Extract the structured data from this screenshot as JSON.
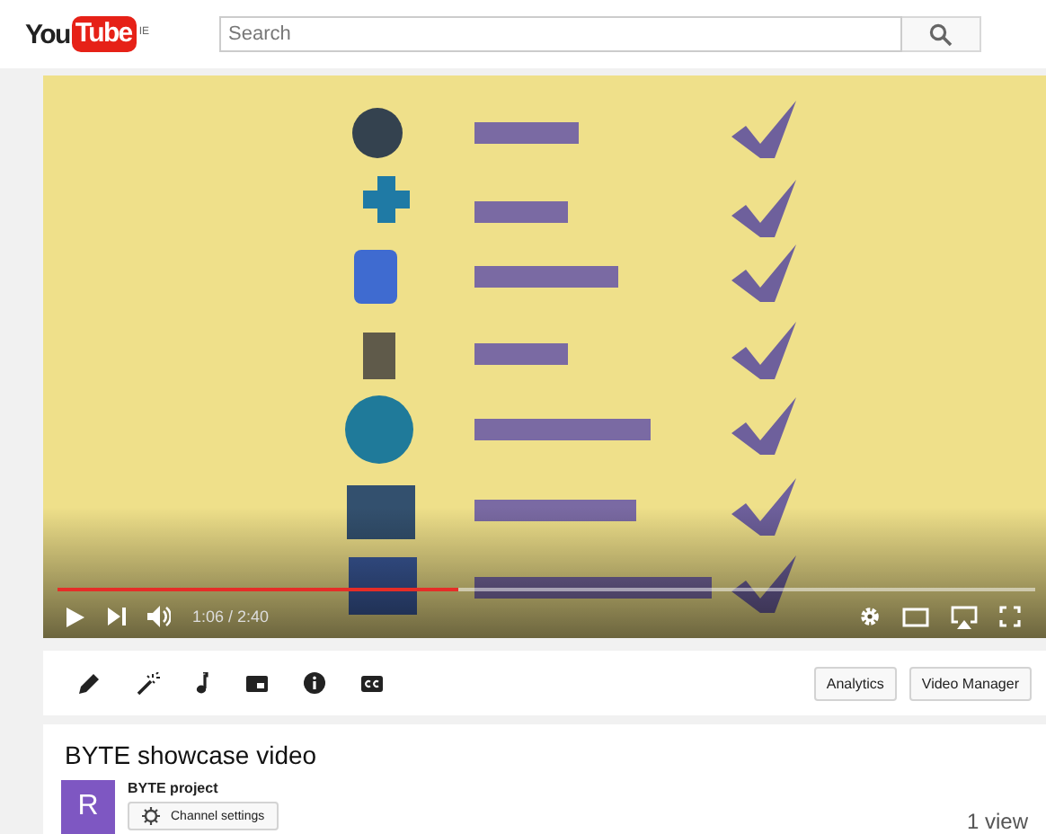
{
  "header": {
    "logo": {
      "word": "You",
      "badge": "Tube",
      "region": "IE"
    },
    "search": {
      "placeholder": "Search"
    }
  },
  "player": {
    "level": 0.41,
    "time": "1:06 / 2:40"
  },
  "toolbar": {
    "tools": [
      {
        "kind": "pencil"
      },
      {
        "kind": "wand"
      },
      {
        "kind": "note"
      },
      {
        "kind": "card"
      },
      {
        "kind": "info"
      },
      {
        "kind": "cc"
      }
    ],
    "buttons": [
      "Analytics",
      "Video Manager"
    ]
  },
  "video": {
    "title": "BYTE showcase video",
    "channel": {
      "avatar": "R",
      "name": "BYTE project",
      "settings": "Channel settings"
    },
    "views": "1 view"
  }
}
